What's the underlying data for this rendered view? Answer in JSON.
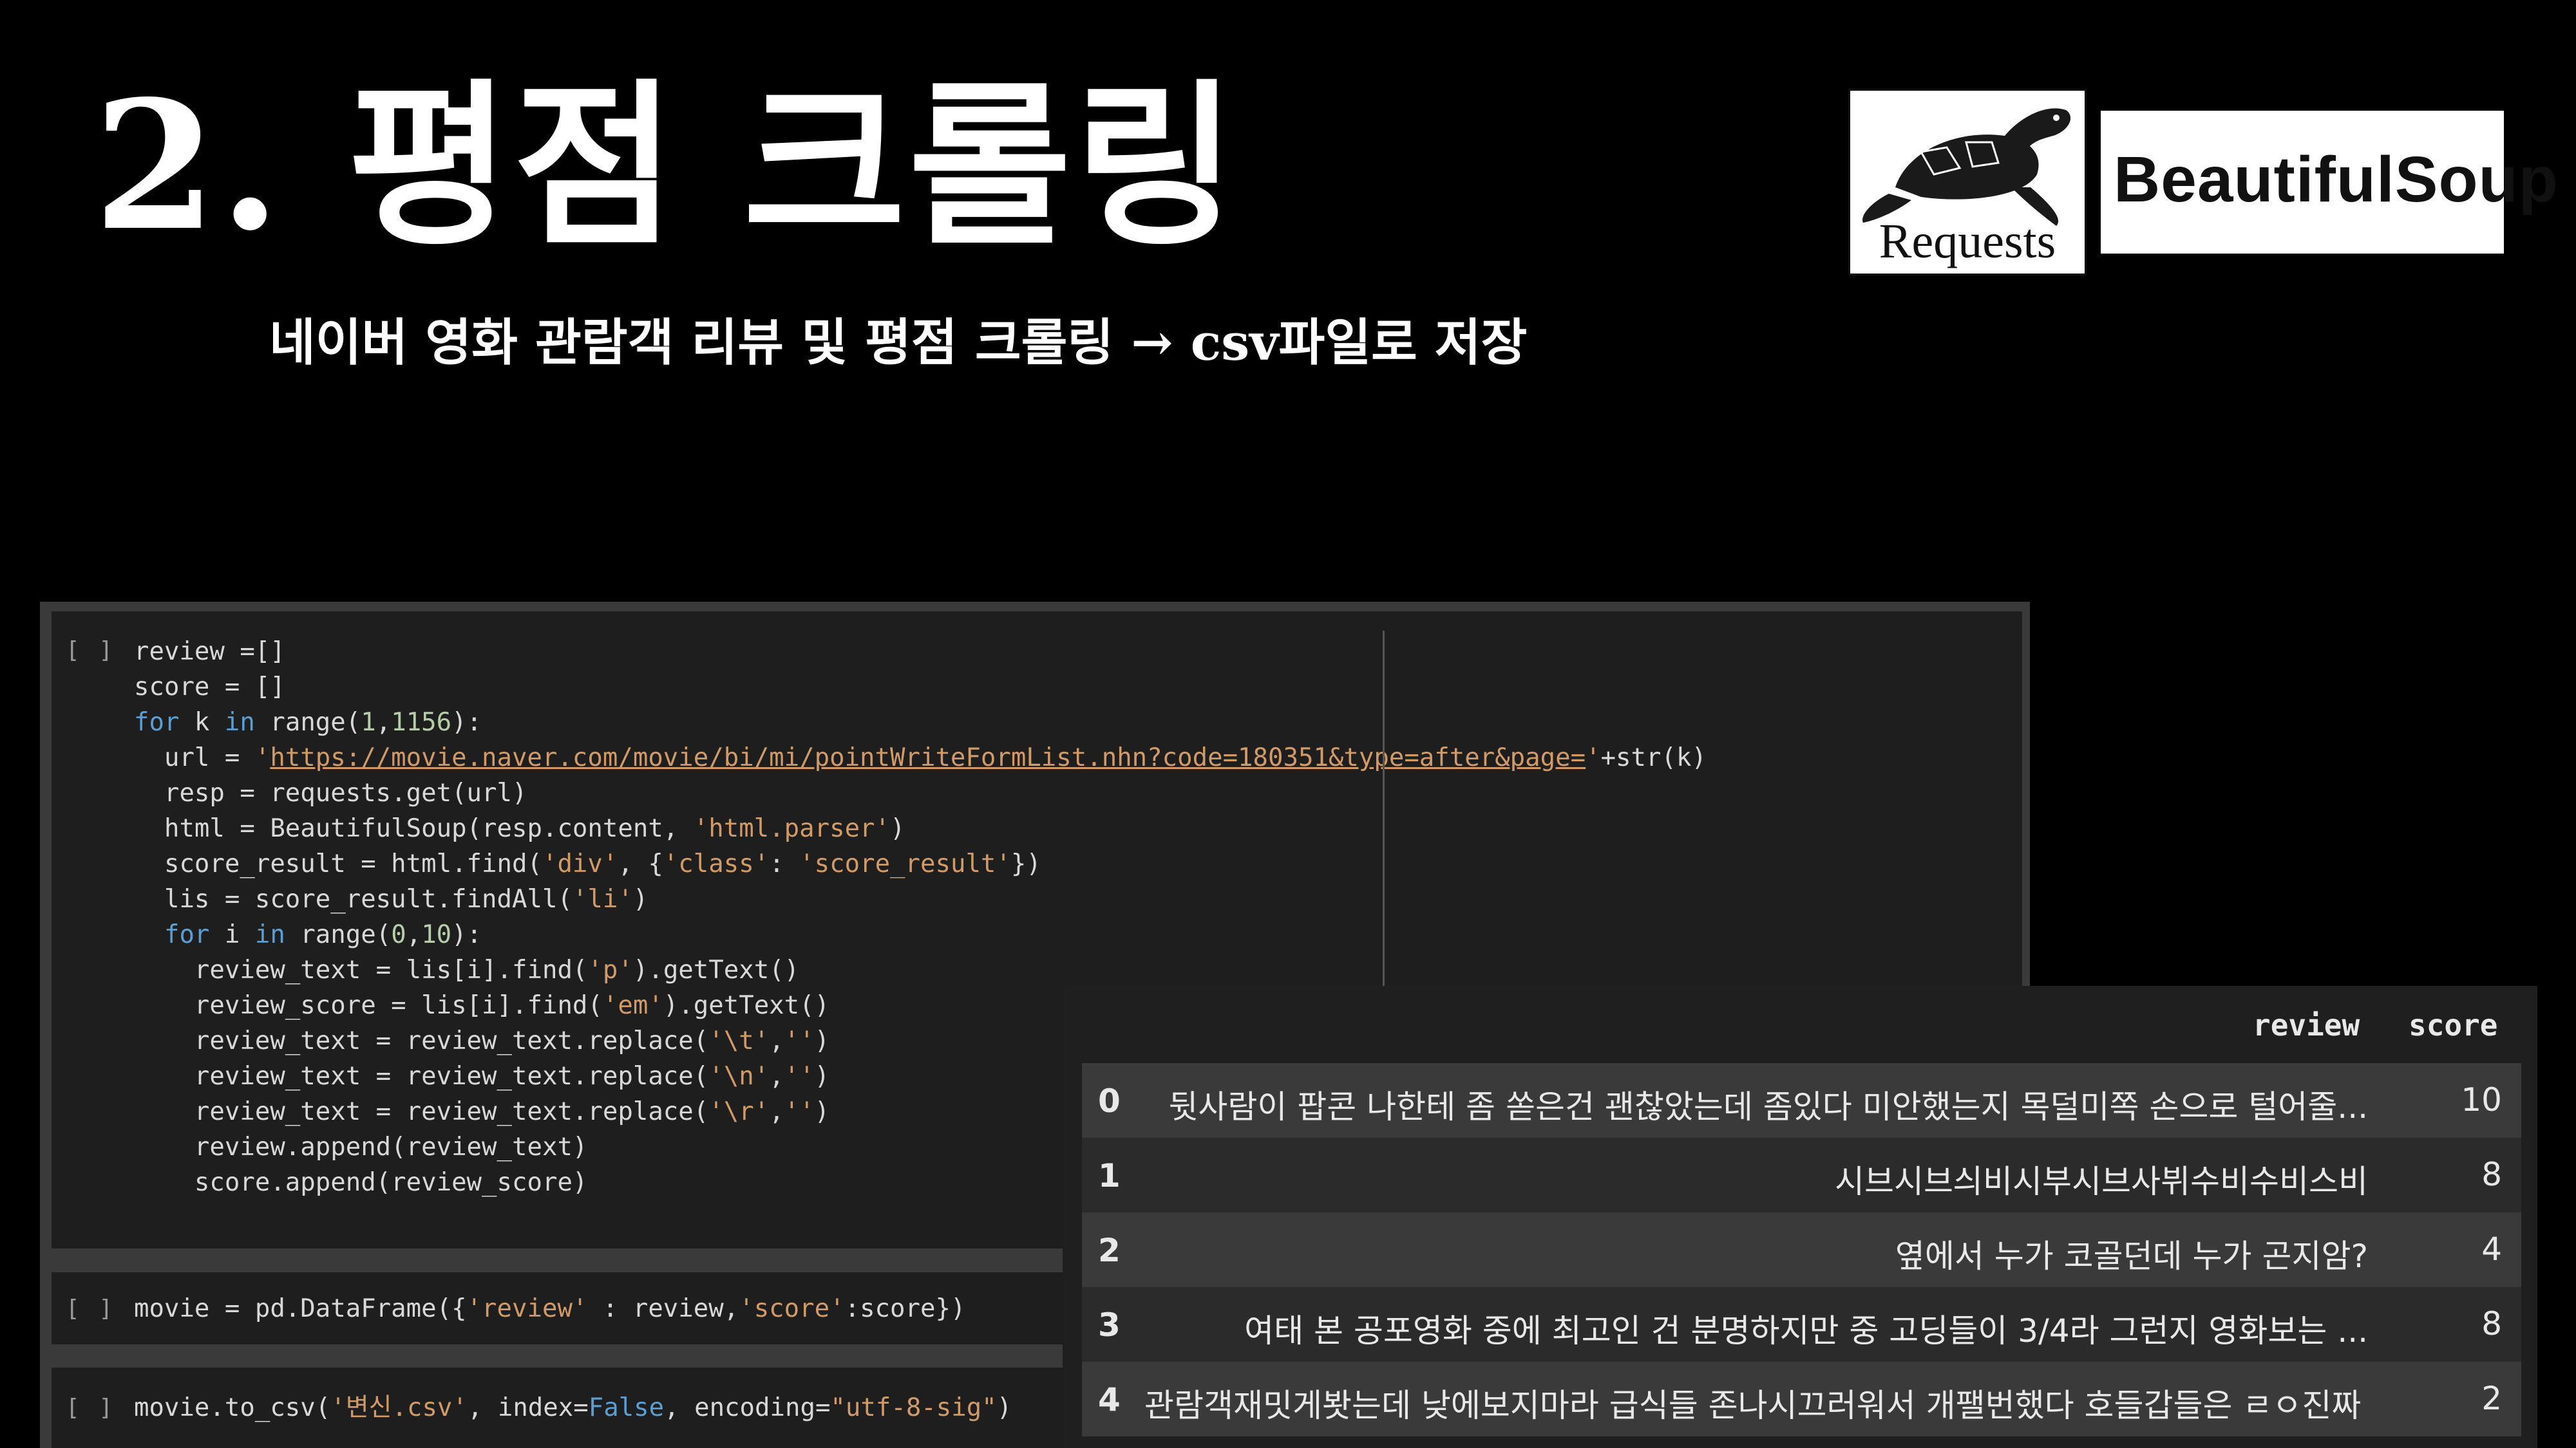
{
  "slide": {
    "title": "2. 평점 크롤링",
    "subtitle": "네이버 영화 관람객 리뷰 및 평점 크롤링 → csv파일로 저장"
  },
  "logos": {
    "requests": "Requests",
    "beautifulsoup": "BeautifulSoup"
  },
  "cells": [
    {
      "prompt": "[ ]",
      "lines": [
        [
          [
            "",
            "review =[]"
          ]
        ],
        [
          [
            "",
            "score = []"
          ]
        ],
        [
          [
            "kw",
            "for"
          ],
          [
            "",
            " k "
          ],
          [
            "kw",
            "in"
          ],
          [
            "",
            " range("
          ],
          [
            "nm",
            "1"
          ],
          [
            "",
            ","
          ],
          [
            "nm",
            "1156"
          ],
          [
            "",
            "):"
          ]
        ],
        [
          [
            "",
            "  url = "
          ],
          [
            "st",
            "'"
          ],
          [
            "url",
            "https://movie.naver.com/movie/bi/mi/pointWriteFormList.nhn?code=180351&type=after&page="
          ],
          [
            "st",
            "'"
          ],
          [
            "",
            "+str(k)"
          ]
        ],
        [
          [
            "",
            "  resp = requests.get(url)"
          ]
        ],
        [
          [
            "",
            "  html = BeautifulSoup(resp.content, "
          ],
          [
            "st",
            "'html.parser'"
          ],
          [
            "",
            ")"
          ]
        ],
        [
          [
            "",
            "  score_result = html.find("
          ],
          [
            "st",
            "'div'"
          ],
          [
            "",
            ", {"
          ],
          [
            "st",
            "'class'"
          ],
          [
            "",
            ": "
          ],
          [
            "st",
            "'score_result'"
          ],
          [
            "",
            "})"
          ]
        ],
        [
          [
            "",
            "  lis = score_result.findAll("
          ],
          [
            "st",
            "'li'"
          ],
          [
            "",
            ")"
          ]
        ],
        [
          [
            "",
            "  "
          ],
          [
            "kw",
            "for"
          ],
          [
            "",
            " i "
          ],
          [
            "kw",
            "in"
          ],
          [
            "",
            " range("
          ],
          [
            "nm",
            "0"
          ],
          [
            "",
            ","
          ],
          [
            "nm",
            "10"
          ],
          [
            "",
            "):"
          ]
        ],
        [
          [
            "",
            "    review_text = lis[i].find("
          ],
          [
            "st",
            "'p'"
          ],
          [
            "",
            ").getText()"
          ]
        ],
        [
          [
            "",
            "    review_score = lis[i].find("
          ],
          [
            "st",
            "'em'"
          ],
          [
            "",
            ").getText()"
          ]
        ],
        [
          [
            "",
            "    review_text = review_text.replace("
          ],
          [
            "st",
            "'\\t'"
          ],
          [
            "",
            ","
          ],
          [
            "st",
            "''"
          ],
          [
            "",
            ")"
          ]
        ],
        [
          [
            "",
            "    review_text = review_text.replace("
          ],
          [
            "st",
            "'\\n'"
          ],
          [
            "",
            ","
          ],
          [
            "st",
            "''"
          ],
          [
            "",
            ")"
          ]
        ],
        [
          [
            "",
            "    review_text = review_text.replace("
          ],
          [
            "st",
            "'\\r'"
          ],
          [
            "",
            ","
          ],
          [
            "st",
            "''"
          ],
          [
            "",
            ")"
          ]
        ],
        [
          [
            "",
            "    review.append(review_text)"
          ]
        ],
        [
          [
            "",
            "    score.append(review_score)"
          ]
        ]
      ]
    },
    {
      "prompt": "[ ]",
      "lines": [
        [
          [
            "",
            "movie = pd.DataFrame({"
          ],
          [
            "st",
            "'review'"
          ],
          [
            "",
            " : review,"
          ],
          [
            "st",
            "'score'"
          ],
          [
            "",
            ":score})"
          ]
        ]
      ]
    },
    {
      "prompt": "[ ]",
      "lines": [
        [
          [
            "",
            "movie.to_csv("
          ],
          [
            "st",
            "'변신.csv'"
          ],
          [
            "",
            ", index="
          ],
          [
            "kw",
            "False"
          ],
          [
            "",
            ", encoding="
          ],
          [
            "st",
            "\"utf-8-sig\""
          ],
          [
            "",
            ")"
          ]
        ]
      ]
    }
  ],
  "dataframe": {
    "columns": [
      "review",
      "score"
    ],
    "rows": [
      {
        "index": "0",
        "review": "뒷사람이 팝콘 나한테 좀 쏟은건 괜찮았는데 좀있다 미안했는지 목덜미쪽 손으로 털어줄...",
        "score": "10"
      },
      {
        "index": "1",
        "review": "시브시브싀비시부시브사뷔수비수비스비",
        "score": "8"
      },
      {
        "index": "2",
        "review": "옆에서 누가 코골던데 누가 곤지암?",
        "score": "4"
      },
      {
        "index": "3",
        "review": "여태 본 공포영화 중에 최고인 건 분명하지만 중 고딩들이 3/4라 그런지 영화보는 ...",
        "score": "8"
      },
      {
        "index": "4",
        "review": "관람객재밋게봣는데 낮에보지마라 급식들 존나시끄러워서 개팰번했다 호들갑들은 ㄹㅇ진짜 ...",
        "score": "2"
      }
    ]
  },
  "colors": {
    "background": "#000000",
    "keyword": "#5a9fd4",
    "string": "#d19a66",
    "number": "#b5cea8"
  }
}
